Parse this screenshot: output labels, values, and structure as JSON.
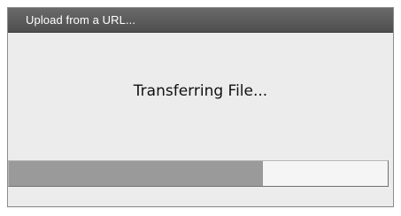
{
  "dialog": {
    "title": "Upload from a URL...",
    "status_text": "Transferring File...",
    "progress": 0.67,
    "colors": {
      "titlebar": "#5a5a5a",
      "background": "#ececec",
      "progress_fill": "#9a9a9a",
      "progress_track": "#f5f5f5"
    }
  }
}
